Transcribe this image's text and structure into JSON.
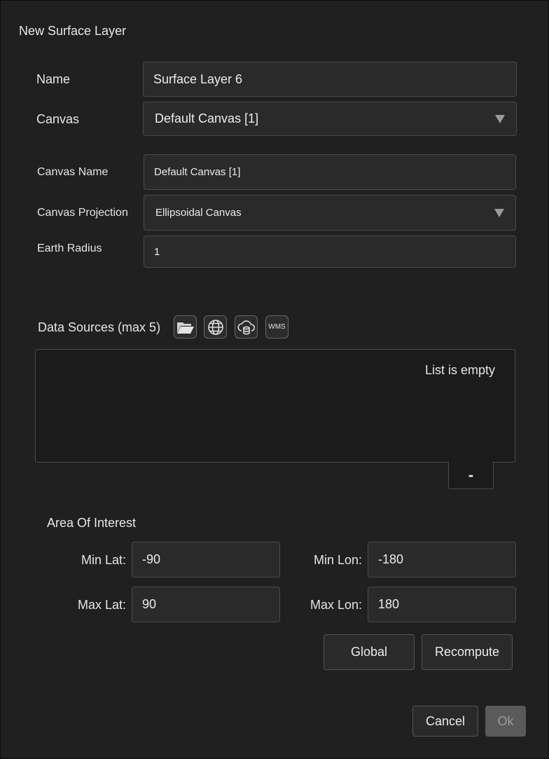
{
  "dialog": {
    "title": "New Surface Layer"
  },
  "name": {
    "label": "Name",
    "value": "Surface Layer 6"
  },
  "canvas": {
    "label": "Canvas",
    "selected": "Default Canvas [1]"
  },
  "canvas_name": {
    "label": "Canvas Name",
    "value": "Default Canvas [1]"
  },
  "canvas_projection": {
    "label": "Canvas Projection",
    "selected": "Ellipsoidal Canvas"
  },
  "earth_radius": {
    "label": "Earth Radius",
    "value": "1"
  },
  "data_sources": {
    "label": "Data Sources (max 5)",
    "icons": [
      "folder-open-icon",
      "globe-icon",
      "cloud-database-icon",
      "wms-icon"
    ],
    "wms_text": "WMS",
    "empty_text": "List is empty",
    "remove_label": "-"
  },
  "area_of_interest": {
    "label": "Area Of Interest",
    "min_lat_label": "Min Lat:",
    "min_lat": "-90",
    "min_lon_label": "Min Lon:",
    "min_lon": "-180",
    "max_lat_label": "Max Lat:",
    "max_lat": "90",
    "max_lon_label": "Max Lon:",
    "max_lon": "180",
    "global_label": "Global",
    "recompute_label": "Recompute"
  },
  "footer": {
    "cancel_label": "Cancel",
    "ok_label": "Ok",
    "ok_enabled": false
  }
}
